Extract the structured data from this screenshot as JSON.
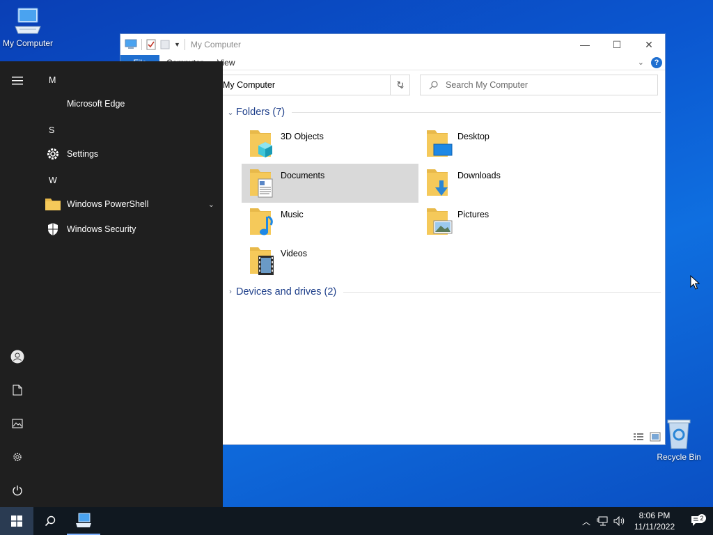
{
  "desktop": {
    "my_computer_label": "My Computer",
    "recycle_bin_label": "Recycle Bin"
  },
  "explorer": {
    "title": "My Computer",
    "ribbon": {
      "file": "File",
      "computer": "Computer",
      "view": "View"
    },
    "address": "My Computer",
    "search_placeholder": "Search My Computer",
    "folders_header": "Folders (7)",
    "folders": [
      {
        "label": "3D Objects",
        "icon": "3d-objects-folder-icon"
      },
      {
        "label": "Desktop",
        "icon": "desktop-folder-icon"
      },
      {
        "label": "Documents",
        "icon": "documents-folder-icon",
        "selected": true
      },
      {
        "label": "Downloads",
        "icon": "downloads-folder-icon"
      },
      {
        "label": "Music",
        "icon": "music-folder-icon"
      },
      {
        "label": "Pictures",
        "icon": "pictures-folder-icon"
      },
      {
        "label": "Videos",
        "icon": "videos-folder-icon"
      }
    ],
    "devices_header": "Devices and drives (2)"
  },
  "start_menu": {
    "letters": {
      "m": "M",
      "s": "S",
      "w": "W"
    },
    "apps": {
      "edge": "Microsoft Edge",
      "settings": "Settings",
      "powershell": "Windows PowerShell",
      "security": "Windows Security"
    }
  },
  "taskbar": {
    "time": "8:06 PM",
    "date": "11/11/2022",
    "notification_count": "2"
  },
  "colors": {
    "accent": "#1f6fd0",
    "start_bg": "#1f1f1f",
    "taskbar_bg": "#101820",
    "folder_yellow": "#f5c95a"
  }
}
